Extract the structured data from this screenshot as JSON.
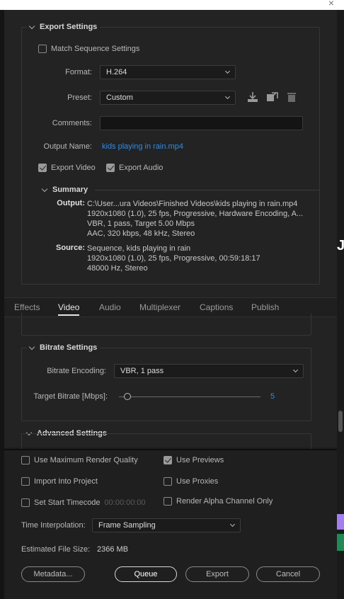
{
  "export_settings": {
    "title": "Export Settings",
    "match_sequence": "Match Sequence Settings",
    "format_label": "Format:",
    "format_value": "H.264",
    "preset_label": "Preset:",
    "preset_value": "Custom",
    "comments_label": "Comments:",
    "comments_value": "",
    "output_name_label": "Output Name:",
    "output_name_value": "kids playing in rain.mp4",
    "export_video": "Export Video",
    "export_audio": "Export Audio"
  },
  "summary": {
    "title": "Summary",
    "output_key": "Output:",
    "output_lines": [
      "C:\\User...ura Videos\\Finished Videos\\kids playing in rain.mp4",
      "1920x1080 (1.0), 25 fps, Progressive, Hardware Encoding, A...",
      "VBR, 1 pass, Target 5.00 Mbps",
      "AAC, 320 kbps, 48 kHz, Stereo"
    ],
    "source_key": "Source:",
    "source_lines": [
      "Sequence, kids playing in rain",
      "1920x1080 (1.0), 25 fps, Progressive, 00:59:18:17",
      "48000 Hz, Stereo"
    ]
  },
  "tabs": [
    "Effects",
    "Video",
    "Audio",
    "Multiplexer",
    "Captions",
    "Publish"
  ],
  "active_tab": "Video",
  "bitrate": {
    "title": "Bitrate Settings",
    "encoding_label": "Bitrate Encoding:",
    "encoding_value": "VBR, 1 pass",
    "target_label": "Target Bitrate [Mbps]:",
    "target_value": "5",
    "slider_fraction": 0.06
  },
  "advanced": {
    "title": "Advanced Settings"
  },
  "options": {
    "max_render": "Use Maximum Render Quality",
    "use_previews": "Use Previews",
    "import_project": "Import Into Project",
    "use_proxies": "Use Proxies",
    "set_start": "Set Start Timecode",
    "start_timecode": "00:00:00:00",
    "alpha_only": "Render Alpha Channel Only",
    "time_interp_label": "Time Interpolation:",
    "time_interp_value": "Frame Sampling",
    "file_size_label": "Estimated File Size:",
    "file_size_value": "2366 MB"
  },
  "buttons": {
    "metadata": "Metadata...",
    "queue": "Queue",
    "export": "Export",
    "cancel": "Cancel"
  },
  "colors": {
    "accent_link": "#2d8ceb",
    "background": "#232323"
  },
  "icons": [
    "save-preset-icon",
    "import-preset-icon",
    "delete-preset-icon"
  ]
}
